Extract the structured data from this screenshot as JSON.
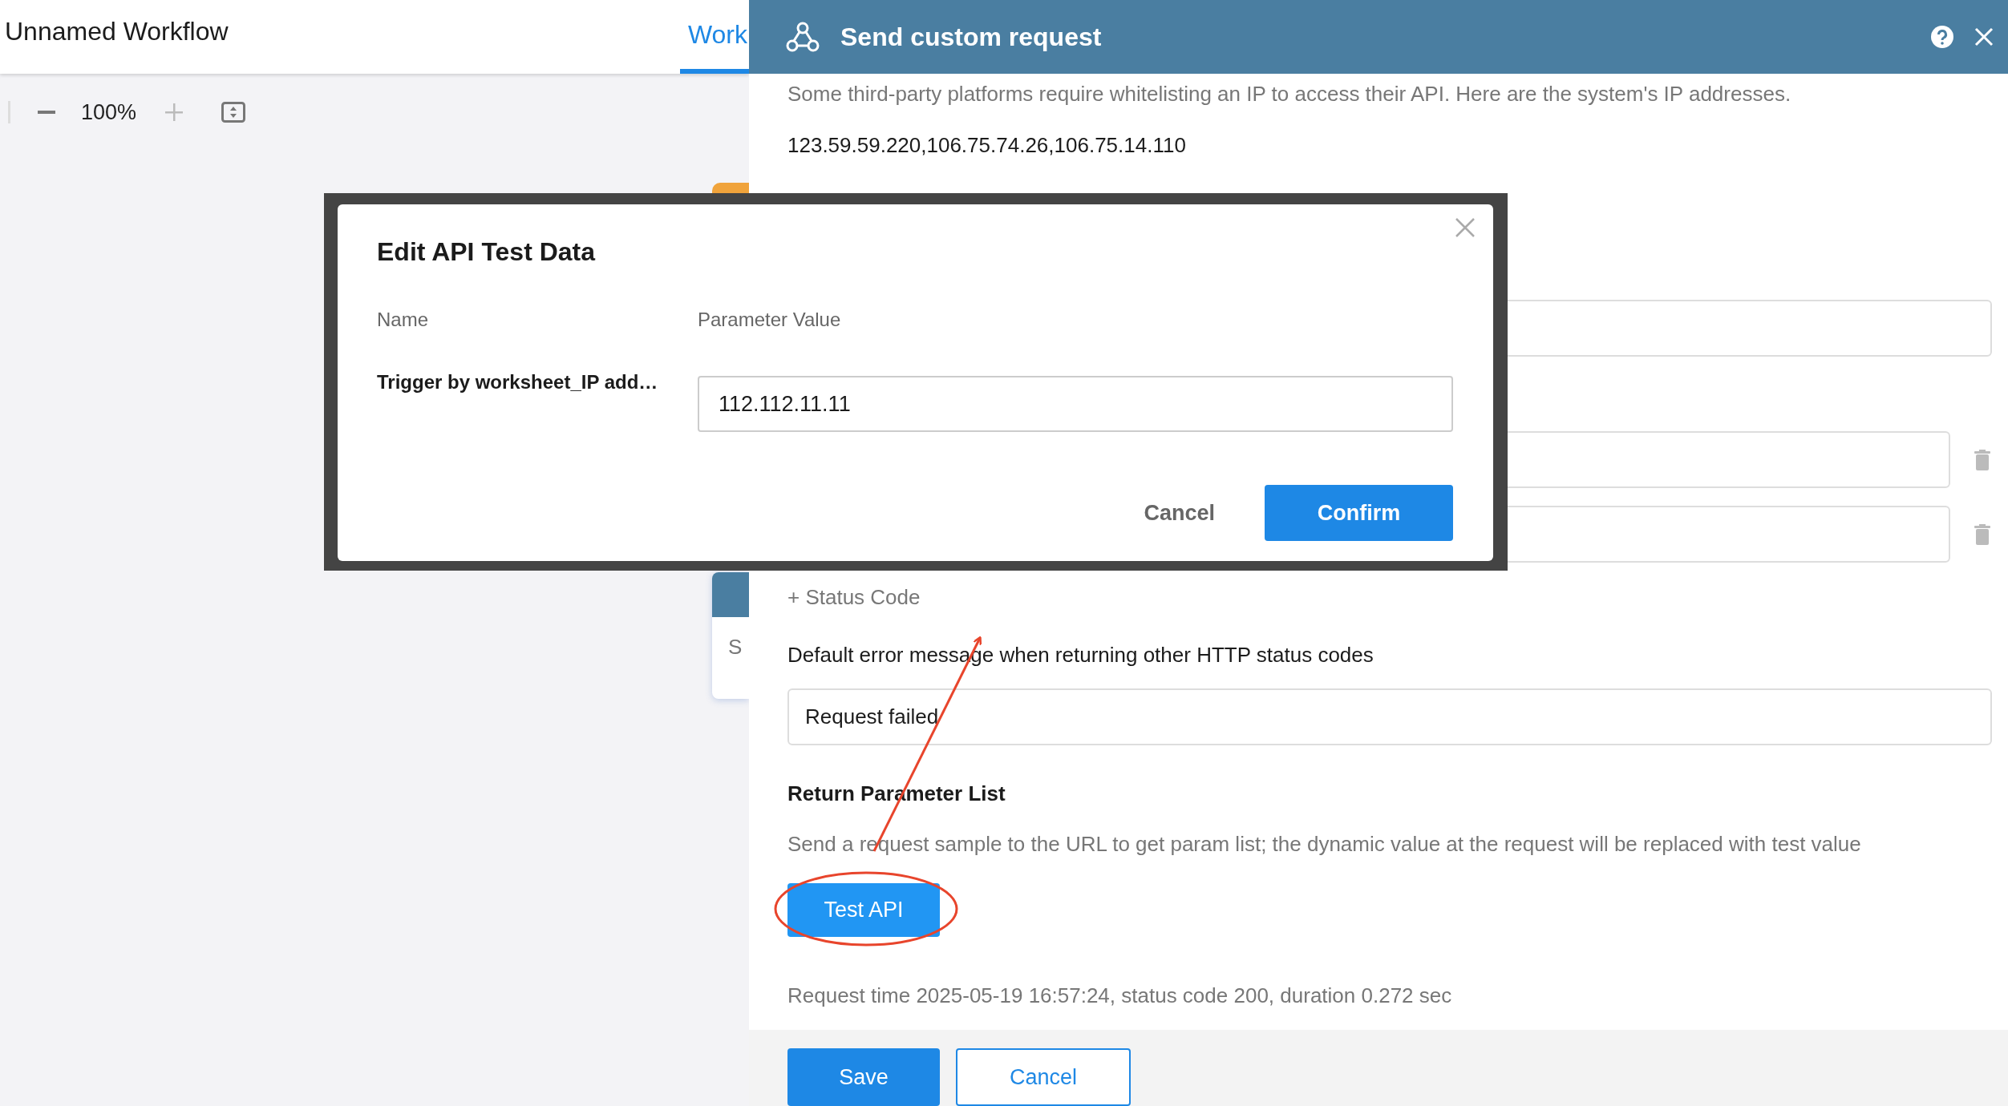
{
  "workflow": {
    "title": "Unnamed Workflow",
    "tabs": [
      {
        "label": "Work",
        "selected": true
      }
    ]
  },
  "toolbar": {
    "zoom": "100%"
  },
  "canvas_node": {
    "text": "S"
  },
  "panel": {
    "title": "Send custom request",
    "whitelist_note": "Some third-party platforms require whitelisting an IP to access their API. Here are the system's IP addresses.",
    "ip_addresses": "123.59.59.220,106.75.74.26,106.75.14.110",
    "request_fields": [
      {
        "deletable": false
      },
      {
        "deletable": true
      },
      {
        "deletable": true
      }
    ],
    "add_status_code": "+ Status Code",
    "error_label": "Default error message when returning other HTTP status codes",
    "error_message": "Request failed",
    "return_title": "Return Parameter List",
    "return_hint": "Send a request sample to the URL to get param list; the dynamic value at the request will be replaced with test value",
    "test_button": "Test API",
    "request_info": "Request time 2025-05-19 16:57:24, status code 200, duration 0.272 sec",
    "buttons": [
      {
        "label": "Save",
        "kind": "primary"
      },
      {
        "label": "Cancel",
        "kind": "outline"
      }
    ]
  },
  "modal": {
    "title": "Edit API Test Data",
    "columns": [
      "Name",
      "Parameter Value"
    ],
    "rows": [
      {
        "name": "Trigger by worksheet_IP add…",
        "value": "112.112.11.11"
      }
    ],
    "buttons": [
      {
        "label": "Cancel",
        "kind": "text"
      },
      {
        "label": "Confirm",
        "kind": "primary"
      }
    ]
  }
}
